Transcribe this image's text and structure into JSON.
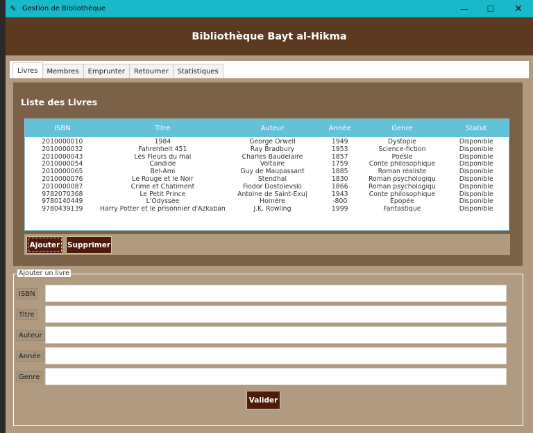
{
  "window": {
    "title": "Gestion de Bibliothèque",
    "controls": [
      "—",
      "☐",
      "✕"
    ]
  },
  "banner": {
    "title": "Bibliothèque Bayt al-Hikma"
  },
  "tabs": [
    "Livres",
    "Membres",
    "Emprunter",
    "Retourner",
    "Statistiques"
  ],
  "books": {
    "title": "Liste des Livres",
    "columns": [
      "ISBN",
      "Titre",
      "Auteur",
      "Année",
      "Genre",
      "Statut"
    ],
    "rows": [
      [
        "2010000010",
        "1984",
        "George Orwell",
        "1949",
        "Dystopie",
        "Disponible"
      ],
      [
        "2010000032",
        "Fahrenheit 451",
        "Ray Bradbury",
        "1953",
        "Science-fiction",
        "Disponible"
      ],
      [
        "2010000043",
        "Les Fleurs du mal",
        "Charles Baudelaire",
        "1857",
        "Poésie",
        "Disponible"
      ],
      [
        "2010000054",
        "Candide",
        "Voltaire",
        "1759",
        "Conte philosophique",
        "Disponible"
      ],
      [
        "2010000065",
        "Bel-Ami",
        "Guy de Maupassant",
        "1885",
        "Roman réaliste",
        "Disponible"
      ],
      [
        "2010000076",
        "Le Rouge et le Noir",
        "Stendhal",
        "1830",
        "Roman psychologiqu",
        "Disponible"
      ],
      [
        "2010000087",
        "Crime et Châtiment",
        "Fiodor Dostoïevski",
        "1866",
        "Roman psychologiqu",
        "Disponible"
      ],
      [
        "9782070368",
        "Le Petit Prince",
        "Antoine de Saint-Exu|",
        "1943",
        "Conte philosophique",
        "Disponible"
      ],
      [
        "9780140449",
        "L'Odyssée",
        "Homère",
        "-800",
        "Épopée",
        "Disponible"
      ],
      [
        "9780439139",
        "Harry Potter et le prisonnier d'Azkaban",
        "J.K. Rowling",
        "1999",
        "Fantastique",
        "Disponible"
      ]
    ],
    "add_label": "Ajouter",
    "delete_label": "Supprimer"
  },
  "form": {
    "legend": "Ajouter un livre",
    "fields": [
      "ISBN",
      "Titre",
      "Auteur",
      "Année",
      "Genre"
    ],
    "values": [
      "",
      "",
      "",
      "",
      ""
    ],
    "submit_label": "Valider"
  },
  "colors": {
    "titlebar": "#19b9c9",
    "banner": "#5c3a21",
    "panel": "#7b6148",
    "background": "#b09a80",
    "button": "#4d1a0c",
    "table_header": "#63c1d8"
  }
}
